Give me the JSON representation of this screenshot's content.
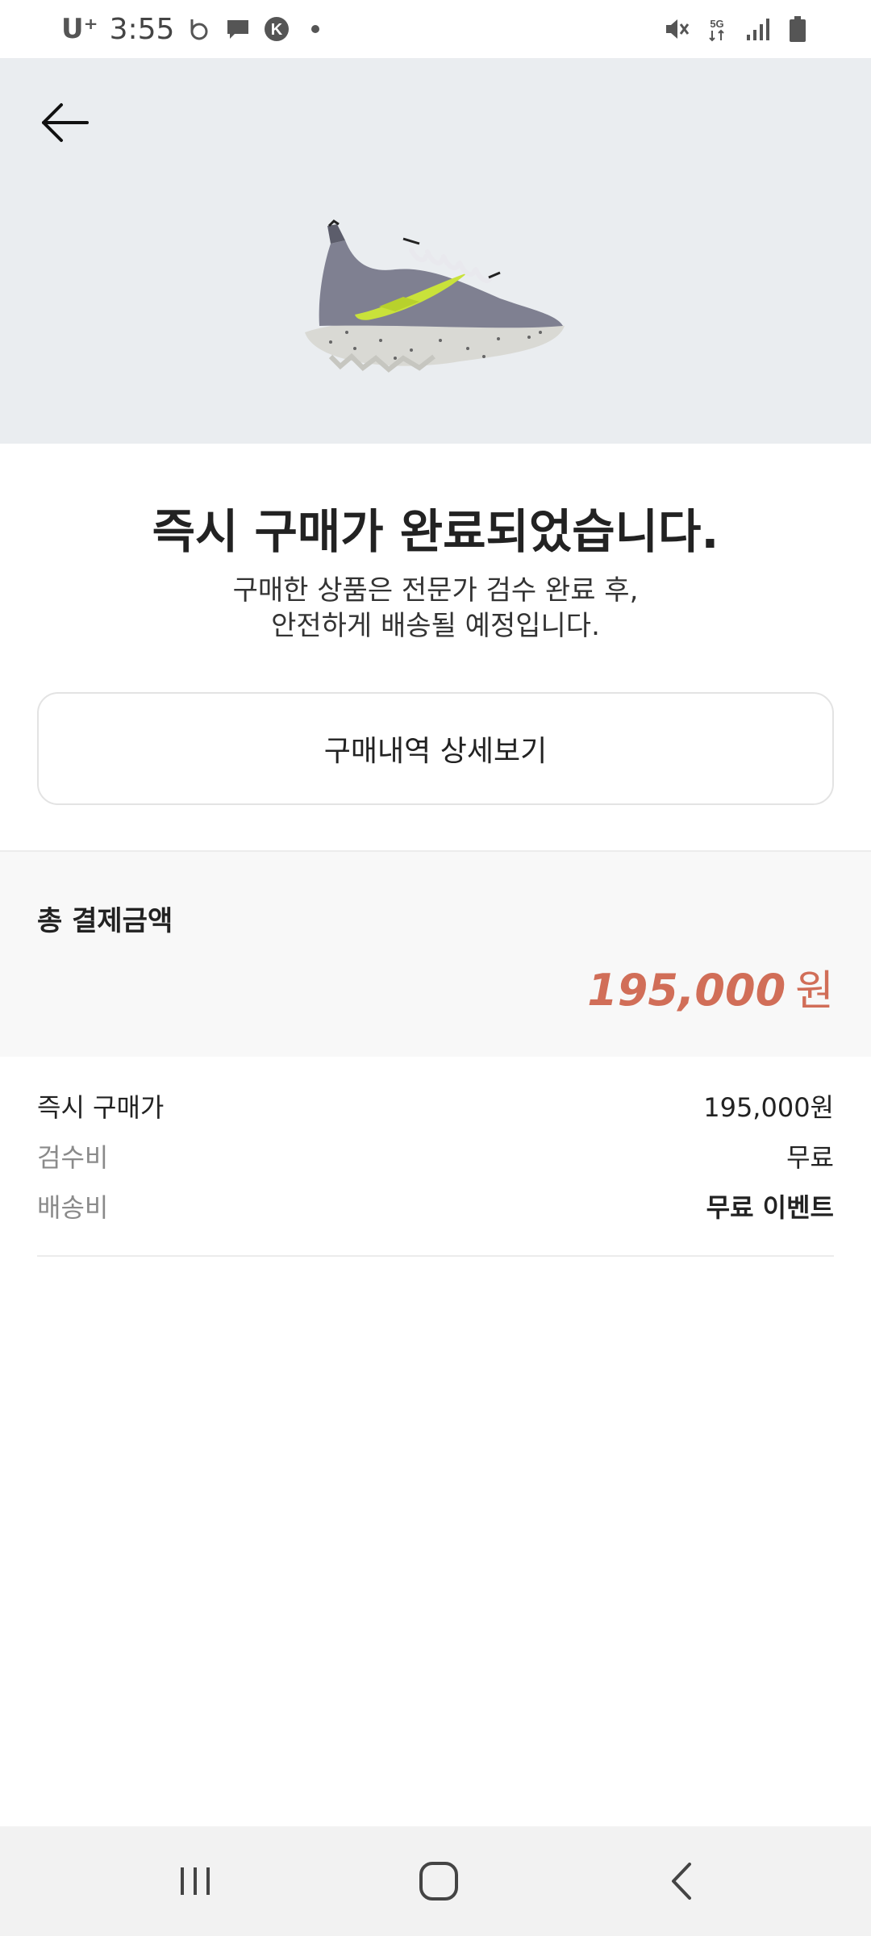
{
  "status_bar": {
    "carrier": "U⁺",
    "time": "3:55",
    "network": "5G"
  },
  "hero": {
    "back_icon": "arrow-left-icon",
    "product_image": "sneaker-product-image",
    "background_color": "#eaedf0"
  },
  "confirmation": {
    "title": "즉시 구매가 완료되었습니다.",
    "subtitle_line1": "구매한 상품은 전문가 검수 완료 후,",
    "subtitle_line2": "안전하게 배송될 예정입니다."
  },
  "detail_button_label": "구매내역 상세보기",
  "total": {
    "label": "총 결제금액",
    "amount": "195,000",
    "unit": "원",
    "accent_color": "#d16e58"
  },
  "breakdown": [
    {
      "label": "즉시 구매가",
      "value": "195,000원"
    },
    {
      "label": "검수비",
      "value": "무료"
    },
    {
      "label": "배송비",
      "value": "무료 이벤트"
    }
  ],
  "nav_bar": {
    "recents_icon": "recents-icon",
    "home_icon": "home-icon",
    "back_icon": "nav-back-icon"
  }
}
